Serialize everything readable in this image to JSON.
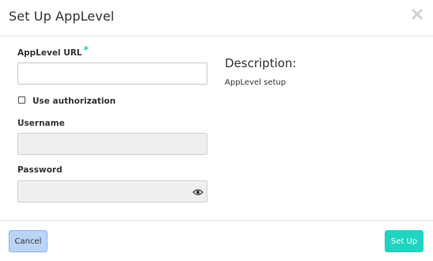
{
  "dialog": {
    "title": "Set Up AppLevel",
    "close_icon": "close-icon"
  },
  "form": {
    "url_label": "AppLevel URL",
    "url_required_marker": "*",
    "url_value": "",
    "use_auth_label": "Use authorization",
    "use_auth_checked": false,
    "username_label": "Username",
    "username_value": "",
    "password_label": "Password",
    "password_value": "",
    "password_toggle_icon": "eye-icon"
  },
  "description": {
    "heading": "Description:",
    "text": "AppLevel setup"
  },
  "footer": {
    "cancel_label": "Cancel",
    "submit_label": "Set Up"
  },
  "colors": {
    "accent": "#1fd4c0",
    "cancel_bg": "#b9d4f6",
    "disabled_bg": "#efefef"
  }
}
